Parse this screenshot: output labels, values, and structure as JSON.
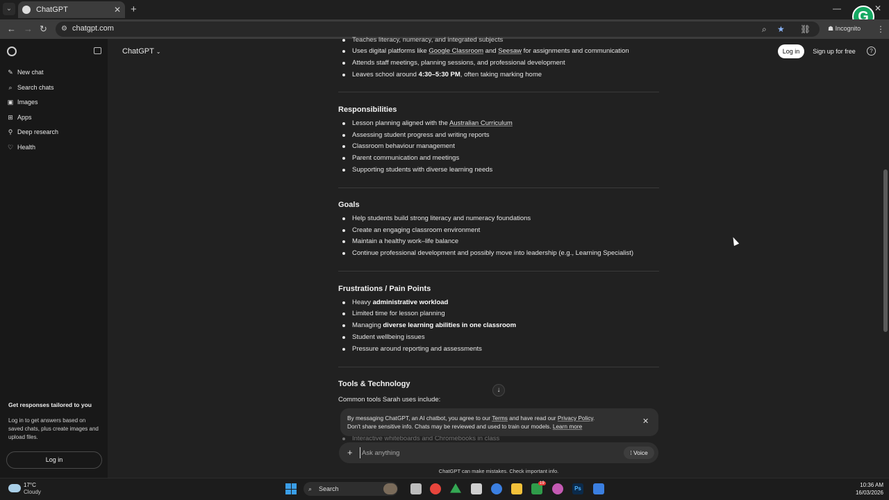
{
  "browser": {
    "tab_title": "ChatGPT",
    "url": "chatgpt.com",
    "incognito_label": "Incognito",
    "extension_letter": "G"
  },
  "sidebar": {
    "items": [
      {
        "label": "New chat",
        "icon": "✎"
      },
      {
        "label": "Search chats",
        "icon": "⌕"
      },
      {
        "label": "Images",
        "icon": "▣"
      },
      {
        "label": "Apps",
        "icon": "⊞"
      },
      {
        "label": "Deep research",
        "icon": "⚲"
      },
      {
        "label": "Health",
        "icon": "♡"
      }
    ],
    "promo_title": "Get responses tailored to you",
    "promo_body": "Log in to get answers based on saved chats, plus create images and upload files.",
    "login_label": "Log in"
  },
  "header": {
    "model": "ChatGPT",
    "login_label": "Log in",
    "signup_label": "Sign up for free",
    "help": "?"
  },
  "content": {
    "top_partial": "Teaches literacy, numeracy, and integrated subjects",
    "day_items": [
      {
        "pre": "Uses digital platforms like ",
        "l1": "Google Classroom",
        "mid": " and ",
        "l2": "Seesaw",
        "post": " for assignments and communication"
      },
      {
        "text": "Attends staff meetings, planning sessions, and professional development"
      },
      {
        "pre": "Leaves school around ",
        "bold": "4:30–5:30 PM",
        "post": ", often taking marking home"
      }
    ],
    "responsibilities_title": "Responsibilities",
    "responsibilities": [
      {
        "pre": "Lesson planning aligned with the ",
        "link": "Australian Curriculum"
      },
      {
        "text": "Assessing student progress and writing reports"
      },
      {
        "text": "Classroom behaviour management"
      },
      {
        "text": "Parent communication and meetings"
      },
      {
        "text": "Supporting students with diverse learning needs"
      }
    ],
    "goals_title": "Goals",
    "goals": [
      "Help students build strong literacy and numeracy foundations",
      "Create an engaging classroom environment",
      "Maintain a healthy work–life balance",
      "Continue professional development and possibly move into leadership (e.g., Learning Specialist)"
    ],
    "frustrations_title": "Frustrations / Pain Points",
    "frustrations": [
      {
        "pre": "Heavy ",
        "bold": "administrative workload"
      },
      {
        "text": "Limited time for lesson planning"
      },
      {
        "pre": "Managing ",
        "bold": "diverse learning abilities in one classroom"
      },
      {
        "text": "Student wellbeing issues"
      },
      {
        "text": "Pressure around reporting and assessments"
      }
    ],
    "tools_title": "Tools & Technology",
    "tools_intro": "Common tools Sarah uses include:",
    "tools_partial": "Interactive whiteboards and Chromebooks in class"
  },
  "notice": {
    "l1_a": "By messaging ChatGPT, an AI chatbot, you agree to our ",
    "terms": "Terms",
    "l1_b": " and have read our ",
    "privacy": "Privacy Policy",
    "l1_c": ".",
    "l2_a": "Don't share sensitive info. Chats may be reviewed and used to train our models. ",
    "learn_more": "Learn more"
  },
  "composer": {
    "placeholder": "Ask anything",
    "voice_label": "Voice",
    "disclaimer": "ChatGPT can make mistakes. Check important info."
  },
  "taskbar": {
    "temp": "17°C",
    "condition": "Cloudy",
    "search_label": "Search",
    "time": "10:36 AM",
    "date": "16/03/2026",
    "badge": "19",
    "colors": {
      "start": "#3a9ee8",
      "chrome": "#e8453c",
      "drive": "#34a853",
      "folder": "#f3c13a"
    }
  }
}
